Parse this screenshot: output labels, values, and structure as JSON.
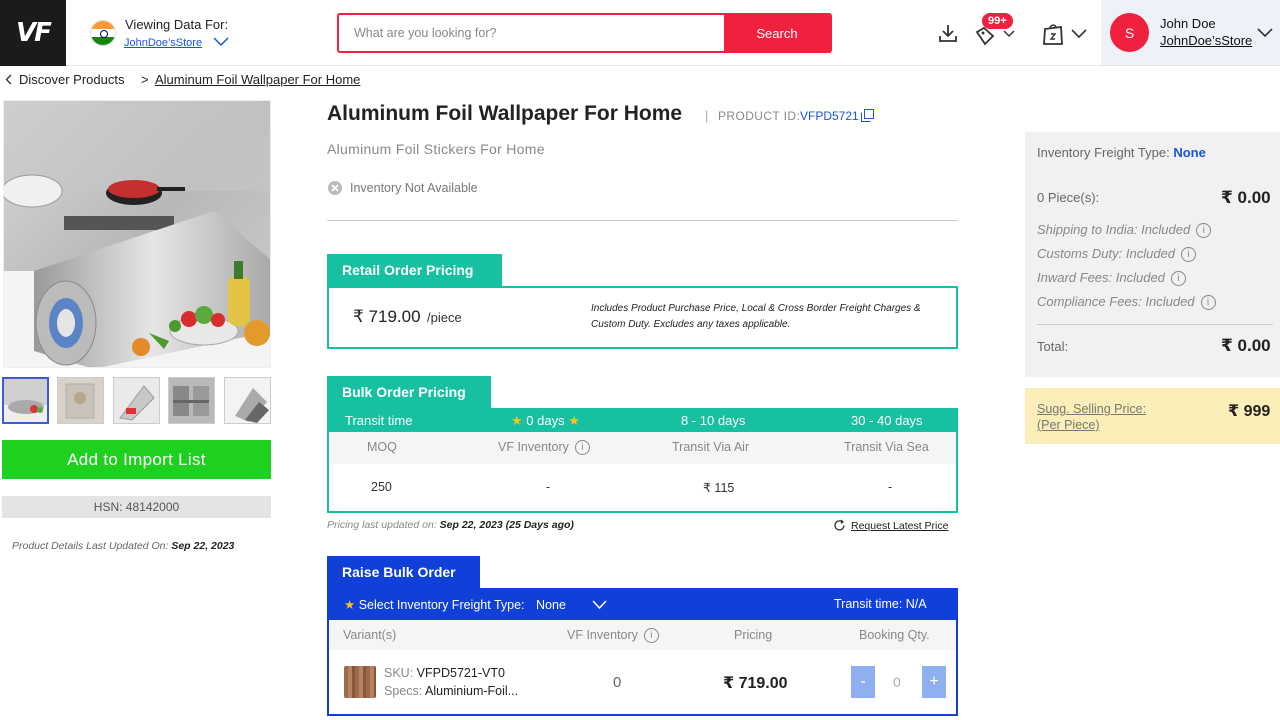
{
  "header": {
    "logo": "VF",
    "viewing_label": "Viewing Data For:",
    "store_name": "JohnDoe’sStore",
    "search_placeholder": "What are you looking for?",
    "search_button": "Search",
    "notifications_badge": "99+",
    "user": {
      "avatar_initial": "S",
      "name": "John Doe",
      "store": "JohnDoe’sStore"
    }
  },
  "breadcrumb": {
    "parent": "Discover Products",
    "separator": ">",
    "current": "Aluminum Foil Wallpaper For Home"
  },
  "left": {
    "thumbnails_count": 5,
    "add_button": "Add to Import List",
    "hsn": "HSN: 48142000",
    "updated_label": "Product Details Last Updated On:",
    "updated_date": "Sep 22, 2023"
  },
  "product": {
    "title": "Aluminum Foil Wallpaper For Home",
    "id_separator": "|",
    "id_label": "PRODUCT ID:",
    "id_value": "VFPD5721",
    "subtitle": "Aluminum Foil Stickers For Home",
    "inventory_status": "Inventory Not Available"
  },
  "retail": {
    "tab_label": "Retail Order Pricing",
    "price": "₹ 719.00",
    "unit": "/piece",
    "note": "Includes Product Purchase Price, Local & Cross Border Freight Charges & Custom Duty. Excludes any taxes applicable."
  },
  "bulk": {
    "tab_label": "Bulk Order Pricing",
    "header": {
      "transit_time": "Transit time",
      "col1": "0 days",
      "col2": "8 - 10 days",
      "col3": "30 - 40 days"
    },
    "columns": {
      "moq": "MOQ",
      "vf_inventory": "VF Inventory",
      "air": "Transit Via Air",
      "sea": "Transit Via Sea"
    },
    "values": {
      "moq": "250",
      "vf_inventory": "-",
      "air": "₹ 115",
      "sea": "-"
    },
    "pricing_updated_label": "Pricing last updated on:",
    "pricing_updated_value": "Sep 22, 2023 (25 Days ago)",
    "request_price": "Request Latest Price"
  },
  "raise": {
    "tab_label": "Raise Bulk Order",
    "freight_label": "Select Inventory Freight Type:",
    "freight_value": "None",
    "transit": "Transit time: N/A",
    "columns": {
      "variants": "Variant(s)",
      "vf_inventory": "VF Inventory",
      "pricing": "Pricing",
      "booking": "Booking Qty."
    },
    "variant": {
      "sku_label": "SKU:",
      "sku": "VFPD5721-VT0",
      "specs_label": "Specs:",
      "specs": "Aluminium-Foil...",
      "inventory": "0",
      "price": "₹ 719.00",
      "qty": "0",
      "minus": "-",
      "plus": "+"
    }
  },
  "summary": {
    "freight_label": "Inventory Freight Type:",
    "freight_value": "None",
    "pieces_label": "0 Piece(s):",
    "pieces_amount": "₹ 0.00",
    "shipping": "Shipping to India: Included",
    "customs": "Customs Duty: Included",
    "inward": "Inward Fees: Included",
    "compliance": "Compliance Fees: Included",
    "total_label": "Total:",
    "total_amount": "₹ 0.00",
    "sugg_label_1": "Sugg. Selling Price:",
    "sugg_label_2": "(Per Piece)",
    "sugg_value": "₹ 999"
  },
  "colors": {
    "brand_red": "#f0213f",
    "teal": "#16c0a0",
    "blue": "#1040d8",
    "green": "#1ed11e",
    "link_blue": "#1a56db"
  }
}
